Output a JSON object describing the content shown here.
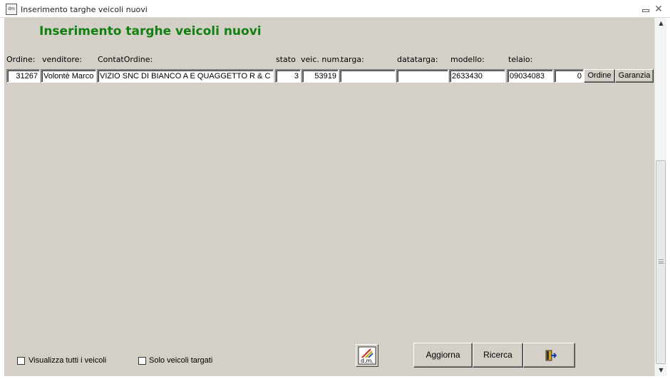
{
  "window": {
    "title": "Inserimento targhe veicoli nuovi"
  },
  "form": {
    "heading": "Inserimento targhe veicoli nuovi",
    "labels": {
      "ordine": "Ordine:",
      "venditore": "venditore:",
      "contat_ordine": "ContatOrdine:",
      "stato": "stato",
      "veic_num": "veic. num.",
      "targa": "targa:",
      "datatarga": "datatarga:",
      "modello": "modello:",
      "telaio": "telaio:"
    },
    "row": {
      "ordine": "31267",
      "venditore": "Volontè Marco",
      "contat_ordine": "VIZIO SNC DI BIANCO A E QUAGGETTO R & C",
      "stato": "3",
      "veic_num": "53919",
      "targa": "",
      "datatarga": "",
      "modello": "2633430",
      "telaio": "09034083",
      "extra": "0"
    },
    "row_buttons": {
      "ordine": "Ordine",
      "garanzia": "Garanzia"
    }
  },
  "footer": {
    "checkbox_tutti": "Visualizza tutti i veicoli",
    "checkbox_targati": "Solo veicoli targati",
    "aggiorna": "Aggiorna",
    "ricerca": "Ricerca",
    "logo_text": "d.m."
  },
  "icons": {
    "app": "app-logo-icon",
    "exit": "exit-door-icon",
    "logo": "dm-logo-icon"
  }
}
